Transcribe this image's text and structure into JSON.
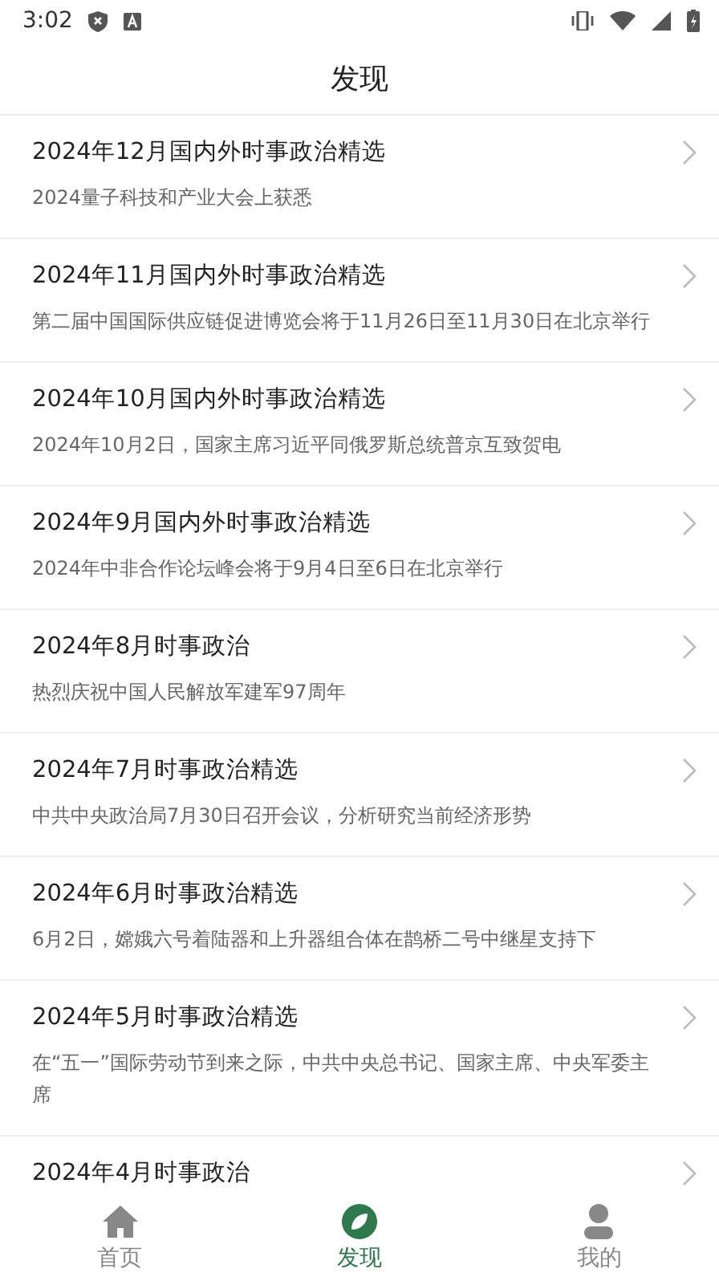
{
  "status_bar": {
    "time": "3:02"
  },
  "header": {
    "title": "发现"
  },
  "articles": [
    {
      "title": "2024年12月国内外时事政治精选",
      "summary": "2024量子科技和产业大会上获悉"
    },
    {
      "title": "2024年11月国内外时事政治精选",
      "summary": "第二届中国国际供应链促进博览会将于11月26日至11月30日在北京举行"
    },
    {
      "title": "2024年10月国内外时事政治精选",
      "summary": "2024年10月2日，国家主席习近平同俄罗斯总统普京互致贺电"
    },
    {
      "title": "2024年9月国内外时事政治精选",
      "summary": "2024年中非合作论坛峰会将于9月4日至6日在北京举行"
    },
    {
      "title": "2024年8月时事政治",
      "summary": "热烈庆祝中国人民解放军建军97周年"
    },
    {
      "title": "2024年7月时事政治精选",
      "summary": "中共中央政治局7月30日召开会议，分析研究当前经济形势"
    },
    {
      "title": "2024年6月时事政治精选",
      "summary": "6月2日，嫦娥六号着陆器和上升器组合体在鹊桥二号中继星支持下"
    },
    {
      "title": "2024年5月时事政治精选",
      "summary": "在“五一”国际劳动节到来之际，中共中央总书记、国家主席、中央军委主席"
    },
    {
      "title": "2024年4月时事政治"
    }
  ],
  "tab_bar": [
    {
      "kind": "home",
      "label": "首页",
      "selected": false
    },
    {
      "kind": "discover",
      "label": "发现",
      "selected": true
    },
    {
      "kind": "profile",
      "label": "我的",
      "selected": false
    }
  ]
}
